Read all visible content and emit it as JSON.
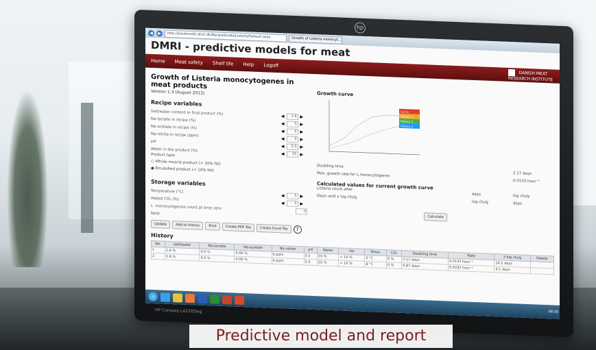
{
  "browser": {
    "url": "http://predmodel.dmri.dk/RecipeStudio/Listeria/Default.aspx",
    "tab": "Growth of Listeria monocyt..."
  },
  "site_title": "DMRI - predictive models for meat",
  "menu": [
    "Home",
    "Meat safety",
    "Shelf life",
    "Help",
    "Logoff"
  ],
  "brand": {
    "line1": "DANISH MEAT",
    "line2": "RESEARCH INSTITUTE"
  },
  "page": {
    "title": "Growth of Listeria monocytogenes in meat products",
    "version": "Version 1.3 (August 2013)"
  },
  "recipe": {
    "heading": "Recipe variables",
    "rows": [
      {
        "label": "Salt/water content in final product (%)",
        "value": "1.6"
      },
      {
        "label": "Na-lactate in recipe (%)",
        "value": "0"
      },
      {
        "label": "Na-acetate in recipe (%)",
        "value": "0"
      },
      {
        "label": "Na-nitrite in recipe (ppm)",
        "value": "0"
      },
      {
        "label": "pH",
        "value": "5.5"
      },
      {
        "label": "Water in the product (%)",
        "value": "55"
      }
    ],
    "product_type_label": "Product type",
    "radio1": "Whole muscle product (> 10% fat)",
    "radio2": "Emulsified product (< 10% fat)"
  },
  "storage": {
    "heading": "Storage variables",
    "rows": [
      {
        "label": "Temperature (°C)",
        "value": "5"
      },
      {
        "label": "Added CO₂ (%)",
        "value": "0"
      }
    ],
    "count_label": "L. monocytogenes count at time zero",
    "count_value": "0",
    "note_label": "Note"
  },
  "buttons": [
    "Update",
    "Add to history",
    "Print",
    "Create PDF file",
    "Create Excel file"
  ],
  "help_icon_text": "?",
  "growth": {
    "title": "Growth curve",
    "doubling_label": "Doubling time",
    "doubling_value": "2.17 days",
    "rate_label": "Max. growth rate for L.monocytogenes",
    "rate_value": "0.0133 hour⁻¹",
    "legend": [
      "Curve",
      "History 1",
      "History 2",
      "History 3"
    ]
  },
  "calc": {
    "heading": "Calculated values for current growth curve",
    "row1_label": "Listeria count after",
    "row1_unit": "days",
    "row1_result": "log cfu/g",
    "row2_label": "Days until x log cfu/g",
    "row2_unit": "log cfu/g",
    "row2_result": "days",
    "button": "Calculate"
  },
  "history": {
    "heading": "History",
    "columns": [
      "No.",
      "Salt/water",
      "Na-lactate",
      "Na-acetate",
      "Na-nitrite",
      "pH",
      "Water",
      "Fat",
      "Temp.",
      "CO₂",
      "Doubling time",
      "Rate",
      "3 log cfu/g",
      "Delete"
    ],
    "rows": [
      [
        "1",
        "1.6 %",
        "0.0 %",
        "0.00 %",
        "0 ppm",
        "5.5",
        "55 %",
        "> 10 %",
        "5 °C",
        "0 %",
        "2.17 days",
        "0.0133 hour⁻¹",
        "14.2 days",
        ""
      ],
      [
        "2",
        "1.6 %",
        "0.0 %",
        "0.00 %",
        "0 ppm",
        "5.5",
        "55 %",
        "> 10 %",
        "8 °C",
        "0 %",
        "0.87 days",
        "0.0332 hour⁻¹",
        "4.1 days",
        ""
      ]
    ]
  },
  "monitor_brand": "HP Compaq LA2205wg",
  "taskbar_clock": "08:30",
  "caption": "Predictive model and report",
  "colors": {
    "menubar": "#7a1616",
    "caption_text": "#7a1e1e",
    "legend": [
      "#e03a2f",
      "#f2a623",
      "#4caf50",
      "#2196f3"
    ]
  }
}
